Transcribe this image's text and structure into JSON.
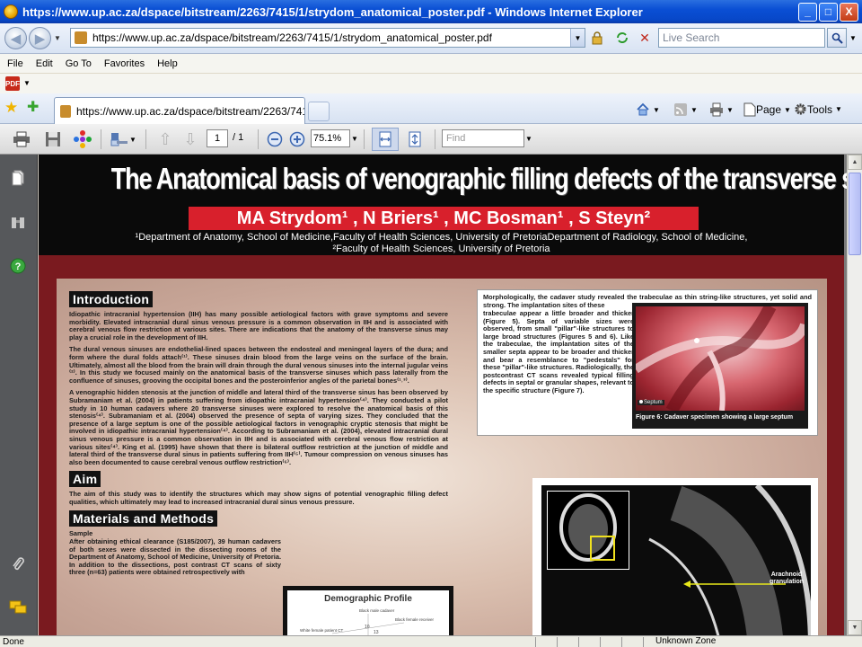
{
  "window": {
    "title": "https://www.up.ac.za/dspace/bitstream/2263/7415/1/strydom_anatomical_poster.pdf - Windows Internet Explorer",
    "minimize": "_",
    "maximize": "□",
    "close": "X"
  },
  "address_bar": {
    "url": "https://www.up.ac.za/dspace/bitstream/2263/7415/1/strydom_anatomical_poster.pdf",
    "search_placeholder": "Live Search"
  },
  "menu": {
    "items": [
      "File",
      "Edit",
      "Go To",
      "Favorites",
      "Help"
    ]
  },
  "tab": {
    "label": "https://www.up.ac.za/dspace/bitstream/2263/7415/..."
  },
  "commands": {
    "page": "Page",
    "tools": "Tools"
  },
  "reader_toolbar": {
    "current_page": "1",
    "page_count": "/ 1",
    "zoom": "75.1%",
    "find_placeholder": "Find"
  },
  "poster": {
    "title": "The Anatomical basis of venographic filling defects of the transverse sinus",
    "authors": "MA Strydom¹ , N Briers¹ , MC Bosman¹ , S Steyn²",
    "affiliation_1": "¹Department of Anatomy, School of Medicine,Faculty of Health Sciences, University of PretoriaDepartment of Radiology, School of Medicine,",
    "affiliation_2": "²Faculty of Health Sciences, University of Pretoria",
    "intro_heading": "Introduction",
    "intro_p1": "Idiopathic intracranial hypertension (IIH) has many possible aetiological factors with grave symptoms and severe morbidity. Elevated intracranial dural sinus venous pressure is a common observation in IIH and is associated with cerebral venous flow restriction at various sites. There are indications that the anatomy of the transverse sinus may play a crucial role in the development of IIH.",
    "intro_p2": "The dural venous sinuses are endothelial-lined spaces between the endosteal and meningeal layers of the dura; and form where the dural folds attach⁽¹⁾. These sinuses drain blood from the large veins on the surface of the brain. Ultimately, almost all the blood from the brain will drain through the dural venous sinuses into the internal jugular veins ⁽²⁾. In this study we focused mainly on the anatomical basis of the transverse sinuses which pass laterally from the confluence of sinuses, grooving the occipital bones and the posteroinferior angles of the parietal bones⁽¹˒³⁾.",
    "intro_p3": "A venographic hidden stenosis at the junction of middle and lateral third of the transverse sinus has been observed by Subramaniam et al. (2004) in patients suffering from idiopathic intracranial hypertension⁽⁴⁾. They conducted a pilot study in 10 human cadavers where 20 transverse sinuses were explored to resolve the anatomical basis of this stenosis⁽⁴⁾. Subramaniam et al. (2004) observed the presence of septa of varying sizes. They concluded that the presence of a large septum is one of the possible aetiological factors in venographic cryptic stenosis that might be involved in idiopathic intracranial hypertension⁽⁴⁾. According to Subramaniam et al. (2004), elevated intracranial dural sinus venous pressure is a common observation in IIH and is associated with cerebral venous flow restriction at various sites⁽⁴⁾. King et al. (1995) have shown that there is bilateral outflow restriction at the junction of middle and lateral third of the transverse dural sinus in patients suffering from IIH⁽⁵⁾. Tumour compression on venous sinuses has also been documented to cause cerebral venous outflow restriction⁽⁶⁾.",
    "aim_heading": "Aim",
    "aim_text": "The aim of this study was to identify the structures which may show signs of potential venographic filling defect qualities, which ultimately may lead to increased intracranial dural sinus venous pressure.",
    "methods_heading": "Materials and Methods",
    "methods_sample": "Sample",
    "methods_text": "After obtaining ethical clearance (S185/2007), 39 human cadavers of both sexes were dissected in the dissecting rooms of the Department of Anatomy, School of Medicine, University of Pretoria. In addition to the dissections, post contrast CT scans of sixty three (n=63) patients were obtained retrospectively with",
    "right_top": "Morphologically, the cadaver study revealed the trabeculae as thin string-like structures, yet solid and strong. The implantation sites of these",
    "right_col": "trabeculae appear a little broader and thicker (Figure 5). Septa of variable sizes were observed, from small \"pillar\"-like structures to large broad structures (Figures 5 and 6). Like the trabeculae, the implantation sites of the smaller septa appear to be broader and thicker and bear a resemblance to \"pedestals\" for these \"pillar\"-like structures. Radiologically, the postcontrast CT scans revealed typical filling defects in septal or granular shapes, relevant to the specific structure (Figure 7).",
    "fig6_tag": "Septum",
    "fig6_caption": "Figure 6: Cadaver specimen showing a large septum",
    "ct_annotation": "Arachnoid granulation",
    "demo_title": "Demographic Profile",
    "demo_labels": [
      "Black male cadaver",
      "Black female receiver",
      "White female patient CT",
      "10",
      "13"
    ]
  },
  "status": {
    "text": "Done",
    "zone": "Unknown Zone"
  }
}
